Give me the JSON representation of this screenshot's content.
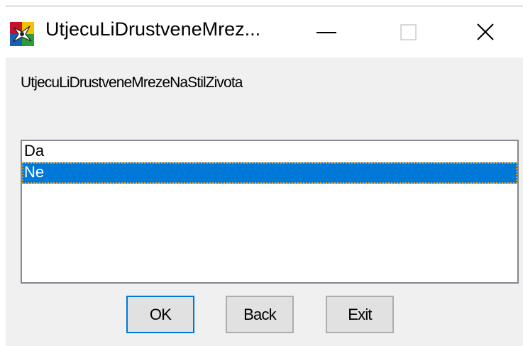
{
  "window": {
    "title": "UtjecuLiDrustveneMrez..."
  },
  "prompt": {
    "text": "UtjecuLiDrustveneMrezeNaStilZivota"
  },
  "list": {
    "items": [
      {
        "label": "Da",
        "selected": false
      },
      {
        "label": "Ne",
        "selected": true
      }
    ]
  },
  "buttons": {
    "ok": "OK",
    "back": "Back",
    "exit": "Exit"
  },
  "colors": {
    "selection": "#0078d7",
    "window_bg": "#f0f0f0",
    "focus_border": "#0078d7"
  },
  "icons": {
    "app": "app-icon",
    "minimize": "minimize-icon",
    "maximize": "maximize-icon",
    "close": "close-icon"
  }
}
